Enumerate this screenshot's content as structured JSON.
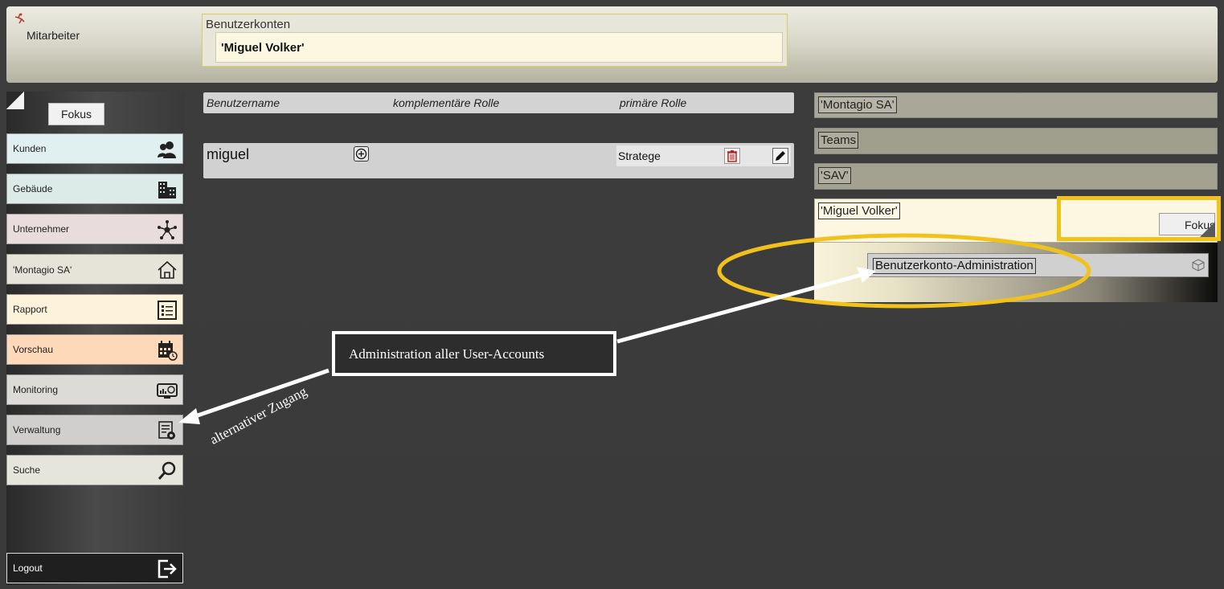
{
  "header": {
    "app_title": "Mitarbeiter",
    "section_label": "Benutzerkonten",
    "section_value": "'Miguel Volker'"
  },
  "sidebar": {
    "fokus_label": "Fokus",
    "items": [
      {
        "label": "Kunden",
        "icon": "users-icon",
        "color": "#e0f0f0"
      },
      {
        "label": "Gebäude",
        "icon": "building-icon",
        "color": "#dcebe7"
      },
      {
        "label": "Unternehmer",
        "icon": "network-icon",
        "color": "#e8dcdc"
      },
      {
        "label": "'Montagio SA'",
        "icon": "home-icon",
        "color": "#e6e4d9"
      },
      {
        "label": "Rapport",
        "icon": "report-icon",
        "color": "#fdf3da"
      },
      {
        "label": "Vorschau",
        "icon": "calendar-icon",
        "color": "#fdd8b9"
      },
      {
        "label": "Monitoring",
        "icon": "monitor-icon",
        "color": "#dcdbd8"
      },
      {
        "label": "Verwaltung",
        "icon": "admin-icon",
        "color": "#d1cece"
      },
      {
        "label": "Suche",
        "icon": "search-icon",
        "color": "#e6e5dc"
      }
    ],
    "logout_label": "Logout"
  },
  "table": {
    "headers": [
      "Benutzername",
      "komplementäre Rolle",
      "primäre Rolle"
    ],
    "rows": [
      {
        "username": "miguel",
        "primary_role": "Stratege"
      }
    ]
  },
  "right_panel": {
    "levels": [
      "'Montagio SA'",
      "Teams",
      "'SAV'",
      "'Miguel Volker'"
    ],
    "fokus_label": "Fokus",
    "sub_item": "Benutzerkonto-Administration"
  },
  "annotations": {
    "note": "Administration aller User-Accounts",
    "alt_access": "alternativer Zugang",
    "highlight_color": "#f1c21c"
  }
}
